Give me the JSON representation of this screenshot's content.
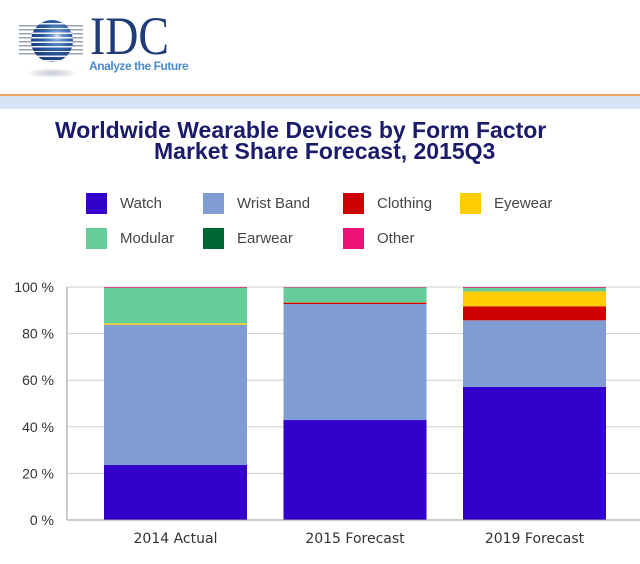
{
  "header": {
    "logo": {
      "icon": "striped-globe-icon",
      "wordmark": "IDC",
      "tagline": "Analyze the Future"
    },
    "colors": {
      "wordmark": "#1F3C78",
      "tagline": "#4B8CD0",
      "divider": "#E8A560",
      "band": "#D5E5F5"
    }
  },
  "chart_data": {
    "type": "bar",
    "stacked": true,
    "title": "Worldwide Wearable Devices by Form Factor Market Share Forecast, 2015Q3",
    "title_lines": [
      "Worldwide Wearable Devices by Form Factor",
      "Market Share Forecast, 2015Q3"
    ],
    "xlabel": "",
    "ylabel": "",
    "categories": [
      "2014 Actual",
      "2015 Forecast",
      "2019 Forecast"
    ],
    "series": [
      {
        "name": "Watch",
        "color": "#3300CC",
        "values": [
          23.6,
          42.9,
          57.1
        ]
      },
      {
        "name": "Wrist Band",
        "color": "#7F9CD3",
        "values": [
          60.2,
          49.8,
          28.6
        ]
      },
      {
        "name": "Clothing",
        "color": "#CC0000",
        "values": [
          0.0,
          0.6,
          6.0
        ]
      },
      {
        "name": "Eyewear",
        "color": "#FFCC00",
        "values": [
          0.6,
          0.1,
          6.4
        ]
      },
      {
        "name": "Modular",
        "color": "#66CC99",
        "values": [
          15.3,
          6.4,
          1.5
        ]
      },
      {
        "name": "Earwear",
        "color": "#006633",
        "values": [
          0.0,
          0.0,
          0.1
        ]
      },
      {
        "name": "Other",
        "color": "#EE1177",
        "values": [
          0.3,
          0.2,
          0.3
        ]
      }
    ],
    "unit": "%",
    "ylim": [
      0,
      100
    ],
    "ytick_values": [
      0,
      20,
      40,
      60,
      80,
      100
    ],
    "ytick_labels": [
      "0 %",
      "20 %",
      "40 %",
      "60 %",
      "80 %",
      "100 %"
    ],
    "grid": true,
    "legend": "top"
  }
}
